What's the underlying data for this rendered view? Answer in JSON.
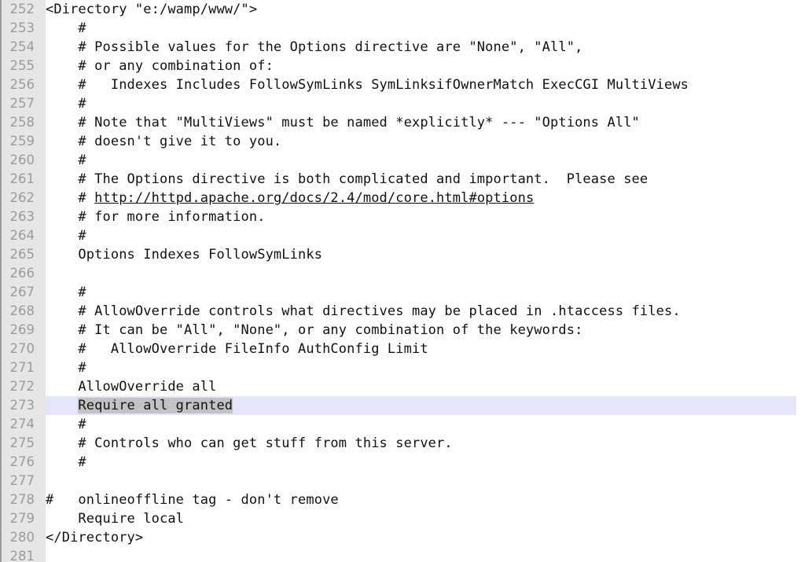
{
  "editor": {
    "app": "text-editor",
    "file_language": "apache-config",
    "colors": {
      "gutter_background": "#e6e6e6",
      "gutter_edge": "#9a9a9a",
      "line_number_text": "#9b9b9b",
      "code_text": "#111111",
      "current_line_highlight": "#e4e5fa",
      "selection_highlight": "#c3c3c3",
      "page_background": "#ffffff"
    },
    "first_line_number": 252,
    "last_line_number": 281,
    "current_line_number": 273,
    "selection": {
      "line": 273,
      "text": "Require all granted"
    },
    "lines": [
      {
        "num": 252,
        "text": "<Directory \"e:/wamp/www/\">"
      },
      {
        "num": 253,
        "text": "    #"
      },
      {
        "num": 254,
        "text": "    # Possible values for the Options directive are \"None\", \"All\","
      },
      {
        "num": 255,
        "text": "    # or any combination of:"
      },
      {
        "num": 256,
        "text": "    #   Indexes Includes FollowSymLinks SymLinksifOwnerMatch ExecCGI MultiViews"
      },
      {
        "num": 257,
        "text": "    #"
      },
      {
        "num": 258,
        "text": "    # Note that \"MultiViews\" must be named *explicitly* --- \"Options All\""
      },
      {
        "num": 259,
        "text": "    # doesn't give it to you."
      },
      {
        "num": 260,
        "text": "    #"
      },
      {
        "num": 261,
        "text": "    # The Options directive is both complicated and important.  Please see"
      },
      {
        "num": 262,
        "text": "    # http://httpd.apache.org/docs/2.4/mod/core.html#options",
        "link": {
          "prefix": "    # ",
          "url": "http://httpd.apache.org/docs/2.4/mod/core.html#options"
        }
      },
      {
        "num": 263,
        "text": "    # for more information."
      },
      {
        "num": 264,
        "text": "    #"
      },
      {
        "num": 265,
        "text": "    Options Indexes FollowSymLinks"
      },
      {
        "num": 266,
        "text": ""
      },
      {
        "num": 267,
        "text": "    #"
      },
      {
        "num": 268,
        "text": "    # AllowOverride controls what directives may be placed in .htaccess files."
      },
      {
        "num": 269,
        "text": "    # It can be \"All\", \"None\", or any combination of the keywords:"
      },
      {
        "num": 270,
        "text": "    #   AllowOverride FileInfo AuthConfig Limit"
      },
      {
        "num": 271,
        "text": "    #"
      },
      {
        "num": 272,
        "text": "    AllowOverride all"
      },
      {
        "num": 273,
        "text": "    Require all granted",
        "current": true,
        "selected": {
          "prefix": "    ",
          "text": "Require all granted"
        }
      },
      {
        "num": 274,
        "text": "    #"
      },
      {
        "num": 275,
        "text": "    # Controls who can get stuff from this server."
      },
      {
        "num": 276,
        "text": "    #"
      },
      {
        "num": 277,
        "text": ""
      },
      {
        "num": 278,
        "text": "#   onlineoffline tag - don't remove"
      },
      {
        "num": 279,
        "text": "    Require local"
      },
      {
        "num": 280,
        "text": "</Directory>"
      },
      {
        "num": 281,
        "text": ""
      }
    ]
  }
}
